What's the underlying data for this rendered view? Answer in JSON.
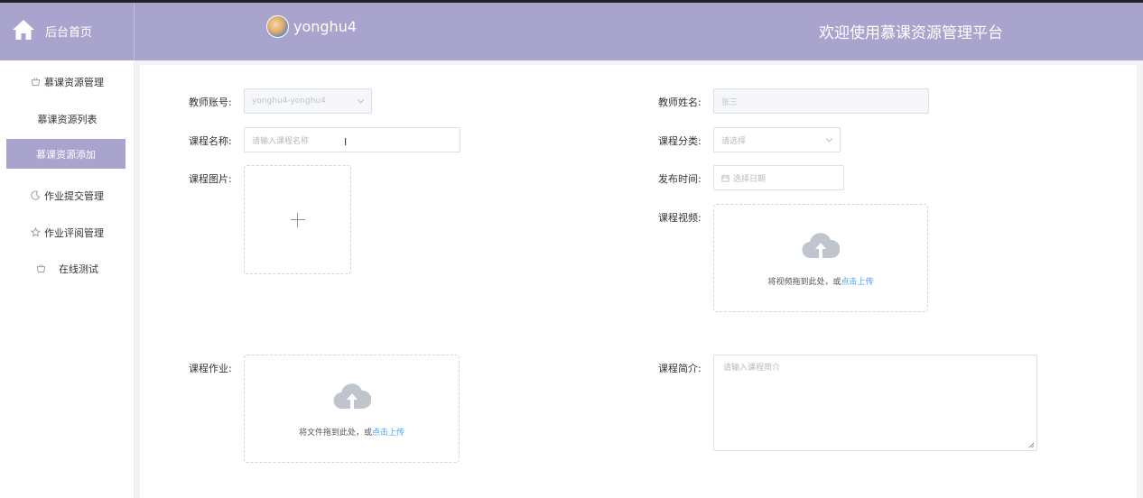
{
  "header": {
    "home_label": "后台首页",
    "username": "yonghu4",
    "welcome": "欢迎使用慕课资源管理平台",
    "color": "#a9a4cd"
  },
  "sidebar": {
    "items": [
      {
        "label": "慕课资源管理",
        "icon": "basket-icon"
      },
      {
        "label": "慕课资源列表"
      },
      {
        "label": "慕课资源添加",
        "active": true
      },
      {
        "label": "作业提交管理",
        "icon": "moon-icon"
      },
      {
        "label": "作业评阅管理",
        "icon": "star-icon"
      },
      {
        "label": "在线测试",
        "icon": "basket-icon"
      }
    ]
  },
  "form": {
    "teacher_account": {
      "label": "教师账号:",
      "value": "yonghu4-yonghu4"
    },
    "teacher_name": {
      "label": "教师姓名:",
      "value": "张三"
    },
    "course_name": {
      "label": "课程名称:",
      "placeholder": "请输入课程名称"
    },
    "course_category": {
      "label": "课程分类:",
      "placeholder": "请选择"
    },
    "course_image": {
      "label": "课程图片:"
    },
    "publish_time": {
      "label": "发布时间:",
      "placeholder": "选择日期"
    },
    "course_video": {
      "label": "课程视频:",
      "hint": "将视频拖到此处，或",
      "link": "点击上传"
    },
    "course_homework": {
      "label": "课程作业:",
      "hint": "将文件拖到此处，或",
      "link": "点击上传"
    },
    "course_intro": {
      "label": "课程简介:",
      "placeholder": "请输入课程简介"
    }
  }
}
